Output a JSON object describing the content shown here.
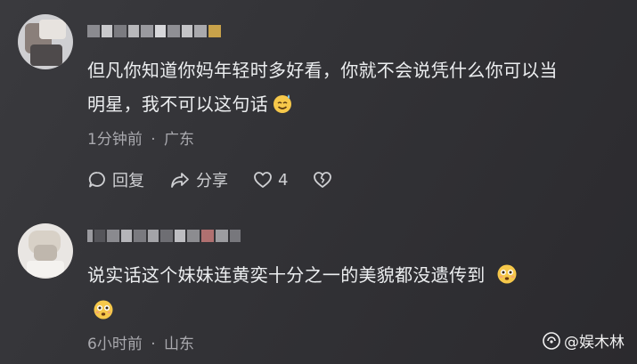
{
  "comments": [
    {
      "username": "",
      "text_line1": "但凡你知道你妈年轻时多好看，你就不会说凭什么你可以当",
      "text_line2": "明星，我不可以这句话",
      "emoji_icon": "smile-sweat-emoji-icon",
      "time": "1分钟前",
      "location": "广东",
      "meta_separator": "·",
      "actions": {
        "reply_label": "回复",
        "share_label": "分享",
        "like_count": "4",
        "dislike_label": ""
      }
    },
    {
      "username": "",
      "text_line1": "说实话这个妹妹连黄奕十分之一的美貌都没遗传到",
      "emoji_icon": "flushed-face-emoji-icon",
      "time": "6小时前",
      "location": "山东",
      "meta_separator": "·"
    }
  ],
  "watermark": {
    "text": "@娱木林"
  },
  "colors": {
    "background": "#333337",
    "text": "#eceef0",
    "meta": "#a9a9ae"
  }
}
